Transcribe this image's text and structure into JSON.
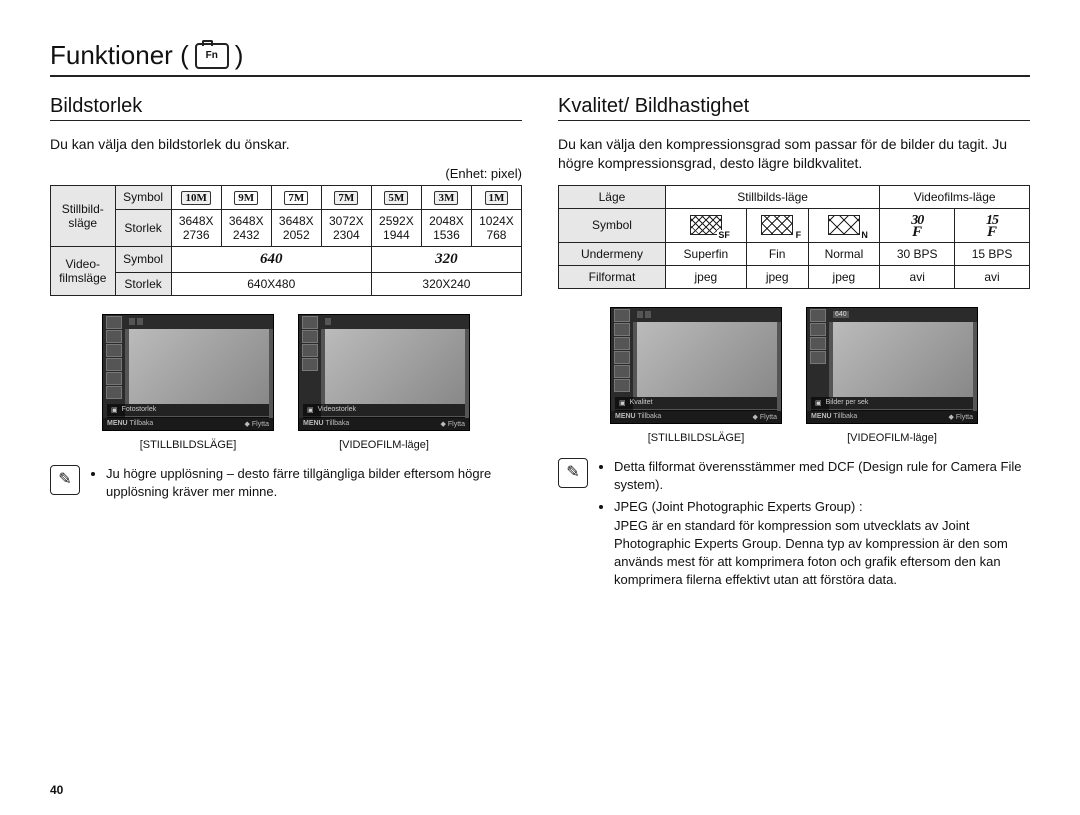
{
  "page_number": "40",
  "title": "Funktioner (",
  "title_close": ")",
  "cam_icon_label": "Fn",
  "left": {
    "heading": "Bildstorlek",
    "intro": "Du kan välja den bildstorlek du önskar.",
    "unit": "(Enhet: pixel)",
    "table": {
      "still_mode_label": "Stillbild-\nsläge",
      "video_mode_label": "Video-\nfilmsläge",
      "row_symbol": "Symbol",
      "row_size": "Storlek",
      "still_symbols": [
        "10M",
        "9M",
        "7M",
        "7M",
        "5M",
        "3M",
        "1M"
      ],
      "still_sizes": [
        "3648X\n2736",
        "3648X\n2432",
        "3648X\n2052",
        "3072X\n2304",
        "2592X\n1944",
        "2048X\n1536",
        "1024X\n768"
      ],
      "video_symbols": [
        "640",
        "320"
      ],
      "video_sizes": [
        "640X480",
        "320X240"
      ]
    },
    "screenshot_labels": {
      "menuname_still": "Fotostorlek",
      "menuname_video": "Videostorlek",
      "strip_still": [
        "10M",
        "10M",
        "9M",
        "7M",
        "7M",
        "5M",
        "3M",
        "1M"
      ],
      "strip_video": [
        "640",
        "640",
        "320"
      ],
      "nav_back": "Tillbaka",
      "nav_move": "Flytta",
      "nav_back_key": "MENU",
      "caption_still": "[STILLBILDSLÄGE]",
      "caption_video": "[VIDEOFILM-läge]"
    },
    "note": "Ju högre upplösning – desto färre tillgängliga bilder eftersom högre upplösning kräver mer minne."
  },
  "right": {
    "heading": "Kvalitet/ Bildhastighet",
    "intro": "Du kan välja den kompressionsgrad som passar för de bilder du tagit. Ju högre kompressionsgrad, desto lägre bildkvalitet.",
    "table": {
      "row_mode": "Läge",
      "mode_still": "Stillbilds-läge",
      "mode_video": "Videofilms-läge",
      "row_symbol": "Symbol",
      "row_submenu": "Undermeny",
      "row_format": "Filformat",
      "quality_icons": [
        "SF",
        "F",
        "N",
        "30",
        "15"
      ],
      "submenu": [
        "Superfin",
        "Fin",
        "Normal",
        "30 BPS",
        "15 BPS"
      ],
      "format": [
        "jpeg",
        "jpeg",
        "jpeg",
        "avi",
        "avi"
      ]
    },
    "screenshot_labels": {
      "menuname_still": "Kvalitet",
      "menuname_video": "Bilder per sek",
      "topbar_video": "640",
      "nav_back": "Tillbaka",
      "nav_move": "Flytta",
      "nav_back_key": "MENU",
      "caption_still": "[STILLBILDSLÄGE]",
      "caption_video": "[VIDEOFILM-läge]"
    },
    "notes": [
      "Detta filformat överensstämmer med DCF (Design rule for Camera File system).",
      "JPEG (Joint Photographic Experts Group) :",
      "JPEG är en standard för kompression som utvecklats av Joint Photographic Experts Group. Denna typ av kompression är den som används mest för att komprimera foton och grafik eftersom den kan komprimera filerna effektivt utan att förstöra data."
    ]
  }
}
